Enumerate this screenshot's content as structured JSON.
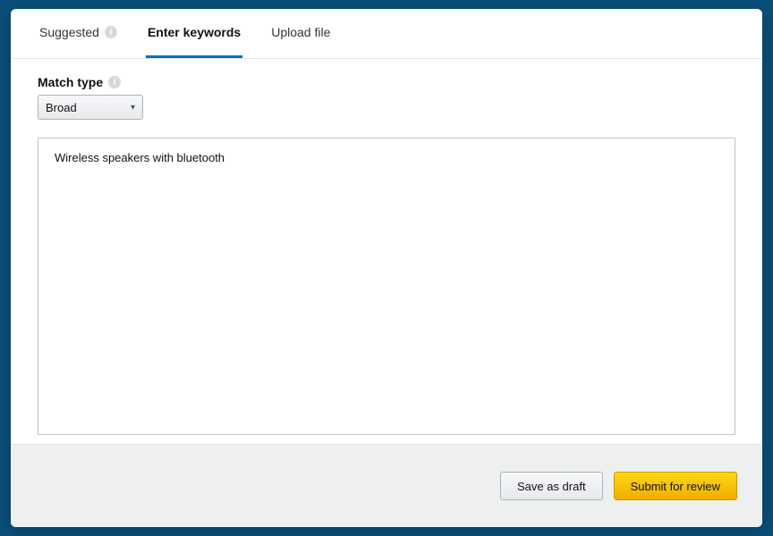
{
  "tabs": {
    "suggested": "Suggested",
    "enter_keywords": "Enter keywords",
    "upload_file": "Upload file"
  },
  "match_type": {
    "label": "Match type",
    "selected": "Broad"
  },
  "keywords_textarea": {
    "value": "Wireless speakers with bluetooth"
  },
  "footer": {
    "save_draft": "Save as draft",
    "submit": "Submit for review"
  }
}
